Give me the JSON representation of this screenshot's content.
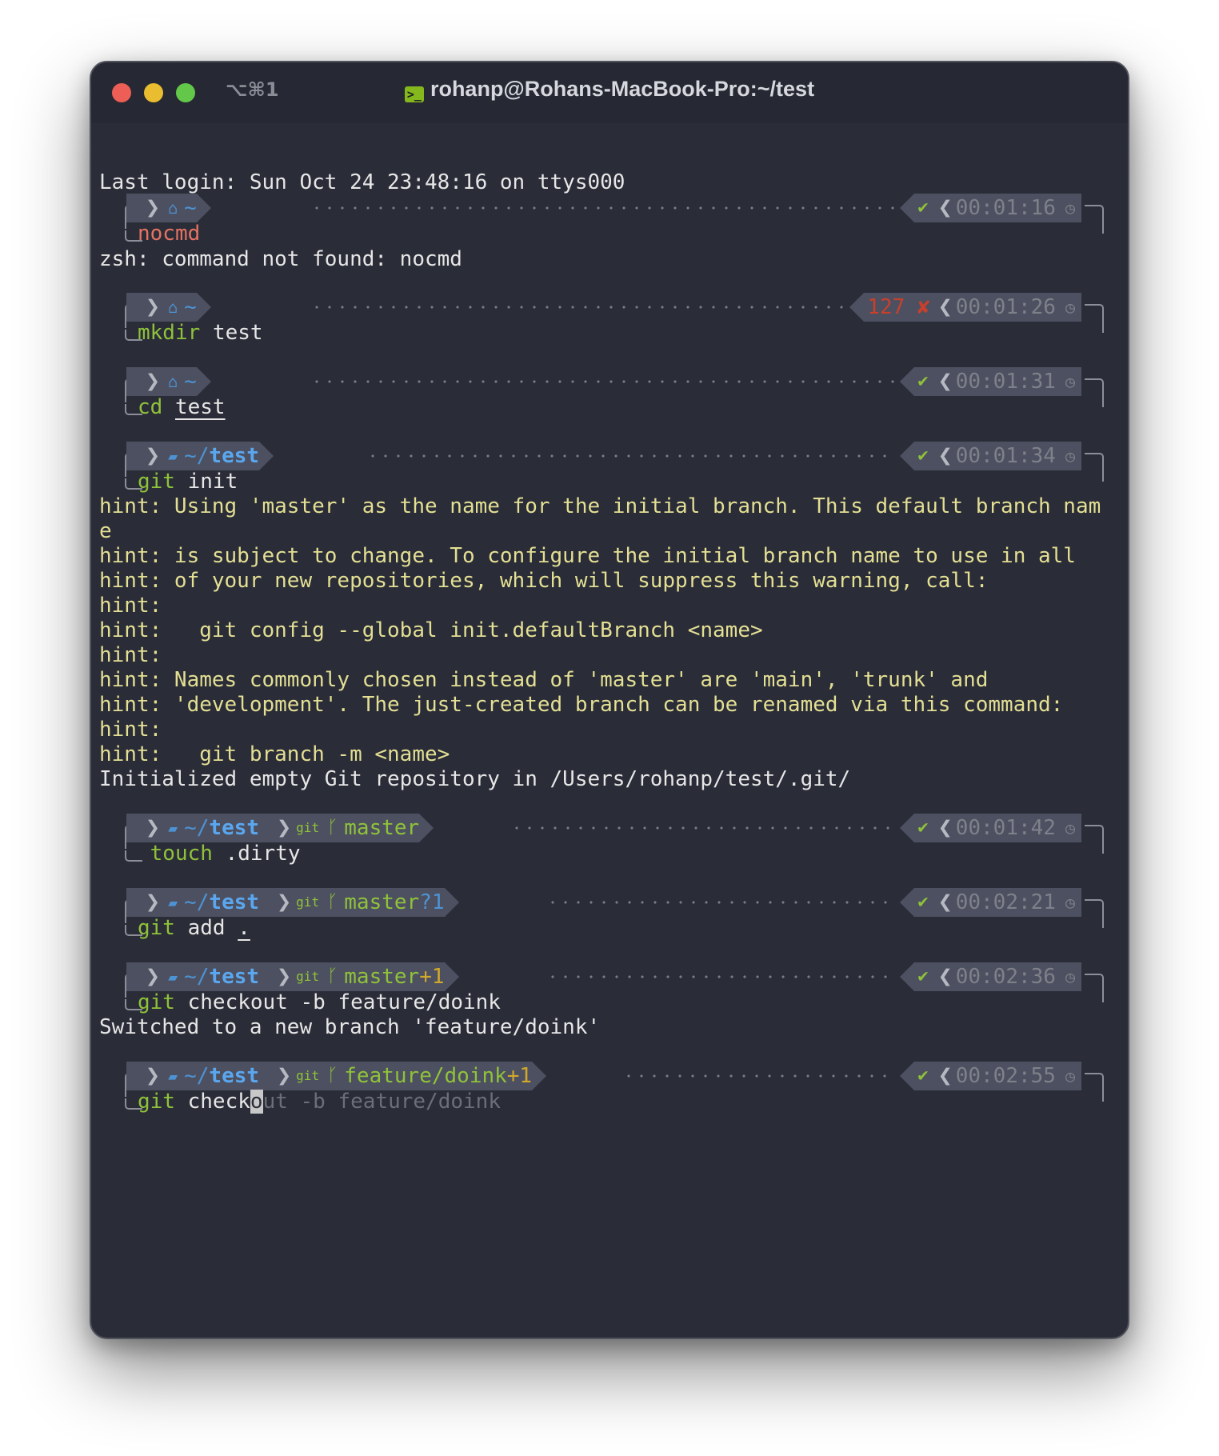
{
  "window": {
    "shortcut": "⌥⌘1",
    "title": "rohanp@Rohans-MacBook-Pro:~/test"
  },
  "login": "Last login: Sun Oct 24 23:48:16 on ttys000",
  "prompts": [
    {
      "dir": "~",
      "status": "✔",
      "time": "00:01:16",
      "cmd": "nocmd"
    },
    {
      "dir": "~",
      "status": "127 ✘",
      "time": "00:01:26",
      "cmd_name": "mkdir",
      "cmd_args": "test"
    },
    {
      "dir": "~",
      "status": "✔",
      "time": "00:01:31",
      "cmd_name": "cd",
      "cmd_args": "test"
    },
    {
      "dir_prefix": "~/",
      "dir_name": "test",
      "status": "✔",
      "time": "00:01:34",
      "cmd_name": "git",
      "cmd_args": "init"
    },
    {
      "dir_prefix": "~/",
      "dir_name": "test",
      "git_label": "git",
      "branch": "master",
      "status": "✔",
      "time": "00:01:42",
      "cmd_name": "touch",
      "cmd_args": ".dirty"
    },
    {
      "dir_prefix": "~/",
      "dir_name": "test",
      "git_label": "git",
      "branch": "master",
      "vcs": "?1",
      "status": "✔",
      "time": "00:02:21",
      "cmd_name": "git",
      "cmd_args": "add",
      "cmd_arg2": "."
    },
    {
      "dir_prefix": "~/",
      "dir_name": "test",
      "git_label": "git",
      "branch": "master",
      "vcs": "+1",
      "status": "✔",
      "time": "00:02:36",
      "cmd_name": "git",
      "cmd_args": "checkout -b feature/doink"
    },
    {
      "dir_prefix": "~/",
      "dir_name": "test",
      "git_label": "git",
      "branch": "feature/doink",
      "vcs": "+1",
      "status": "✔",
      "time": "00:02:55",
      "cmd_name": "git",
      "cmd_typed": "check",
      "cmd_cursor": "o",
      "cmd_ghost": "ut -b feature/doink"
    }
  ],
  "output": {
    "nocmd": "zsh: command not found: nocmd",
    "hints": [
      "hint: Using 'master' as the name for the initial branch. This default branch nam",
      "e",
      "hint: is subject to change. To configure the initial branch name to use in all",
      "hint: of your new repositories, which will suppress this warning, call:",
      "hint:",
      "hint:   git config --global init.defaultBranch <name>",
      "hint:",
      "hint: Names commonly chosen instead of 'master' are 'main', 'trunk' and",
      "hint: 'development'. The just-created branch can be renamed via this command:",
      "hint:",
      "hint:   git branch -m <name>"
    ],
    "init": "Initialized empty Git repository in /Users/rohanp/test/.git/",
    "switched": "Switched to a new branch 'feature/doink'"
  },
  "colors": {
    "background": "#2a2c38",
    "segment": "#4d5060",
    "dir": "#4d93d4",
    "git": "#8fc23a",
    "error": "#c8402c",
    "hint": "#e3df93"
  }
}
